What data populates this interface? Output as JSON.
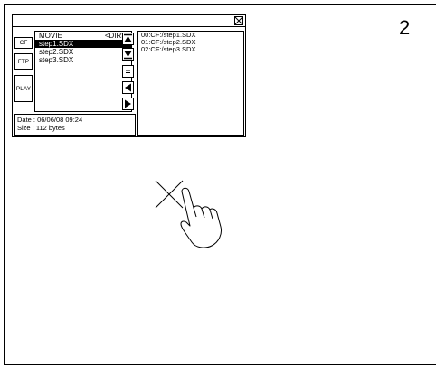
{
  "step_number": "2",
  "side_buttons": [
    "CF",
    "FTP",
    "PLAY"
  ],
  "file_list": {
    "header_name": "MOVIE",
    "header_tag": "<DIR>",
    "items": [
      "step1.SDX",
      "step2.SDX",
      "step3.SDX"
    ],
    "selected_index": 0
  },
  "dest_list": [
    "00:CF:/step1.SDX",
    "01:CF:/step2.SDX",
    "02:CF:/step3.SDX"
  ],
  "info": {
    "date_line": "Date : 06/06/08  09:24",
    "size_line": "Size : 112 bytes"
  },
  "icons": [
    "close-icon",
    "page-up-icon",
    "page-down-icon",
    "equals-icon",
    "arrow-left-icon",
    "arrow-right-icon",
    "tap-hand-icon",
    "cross-mark-icon"
  ]
}
